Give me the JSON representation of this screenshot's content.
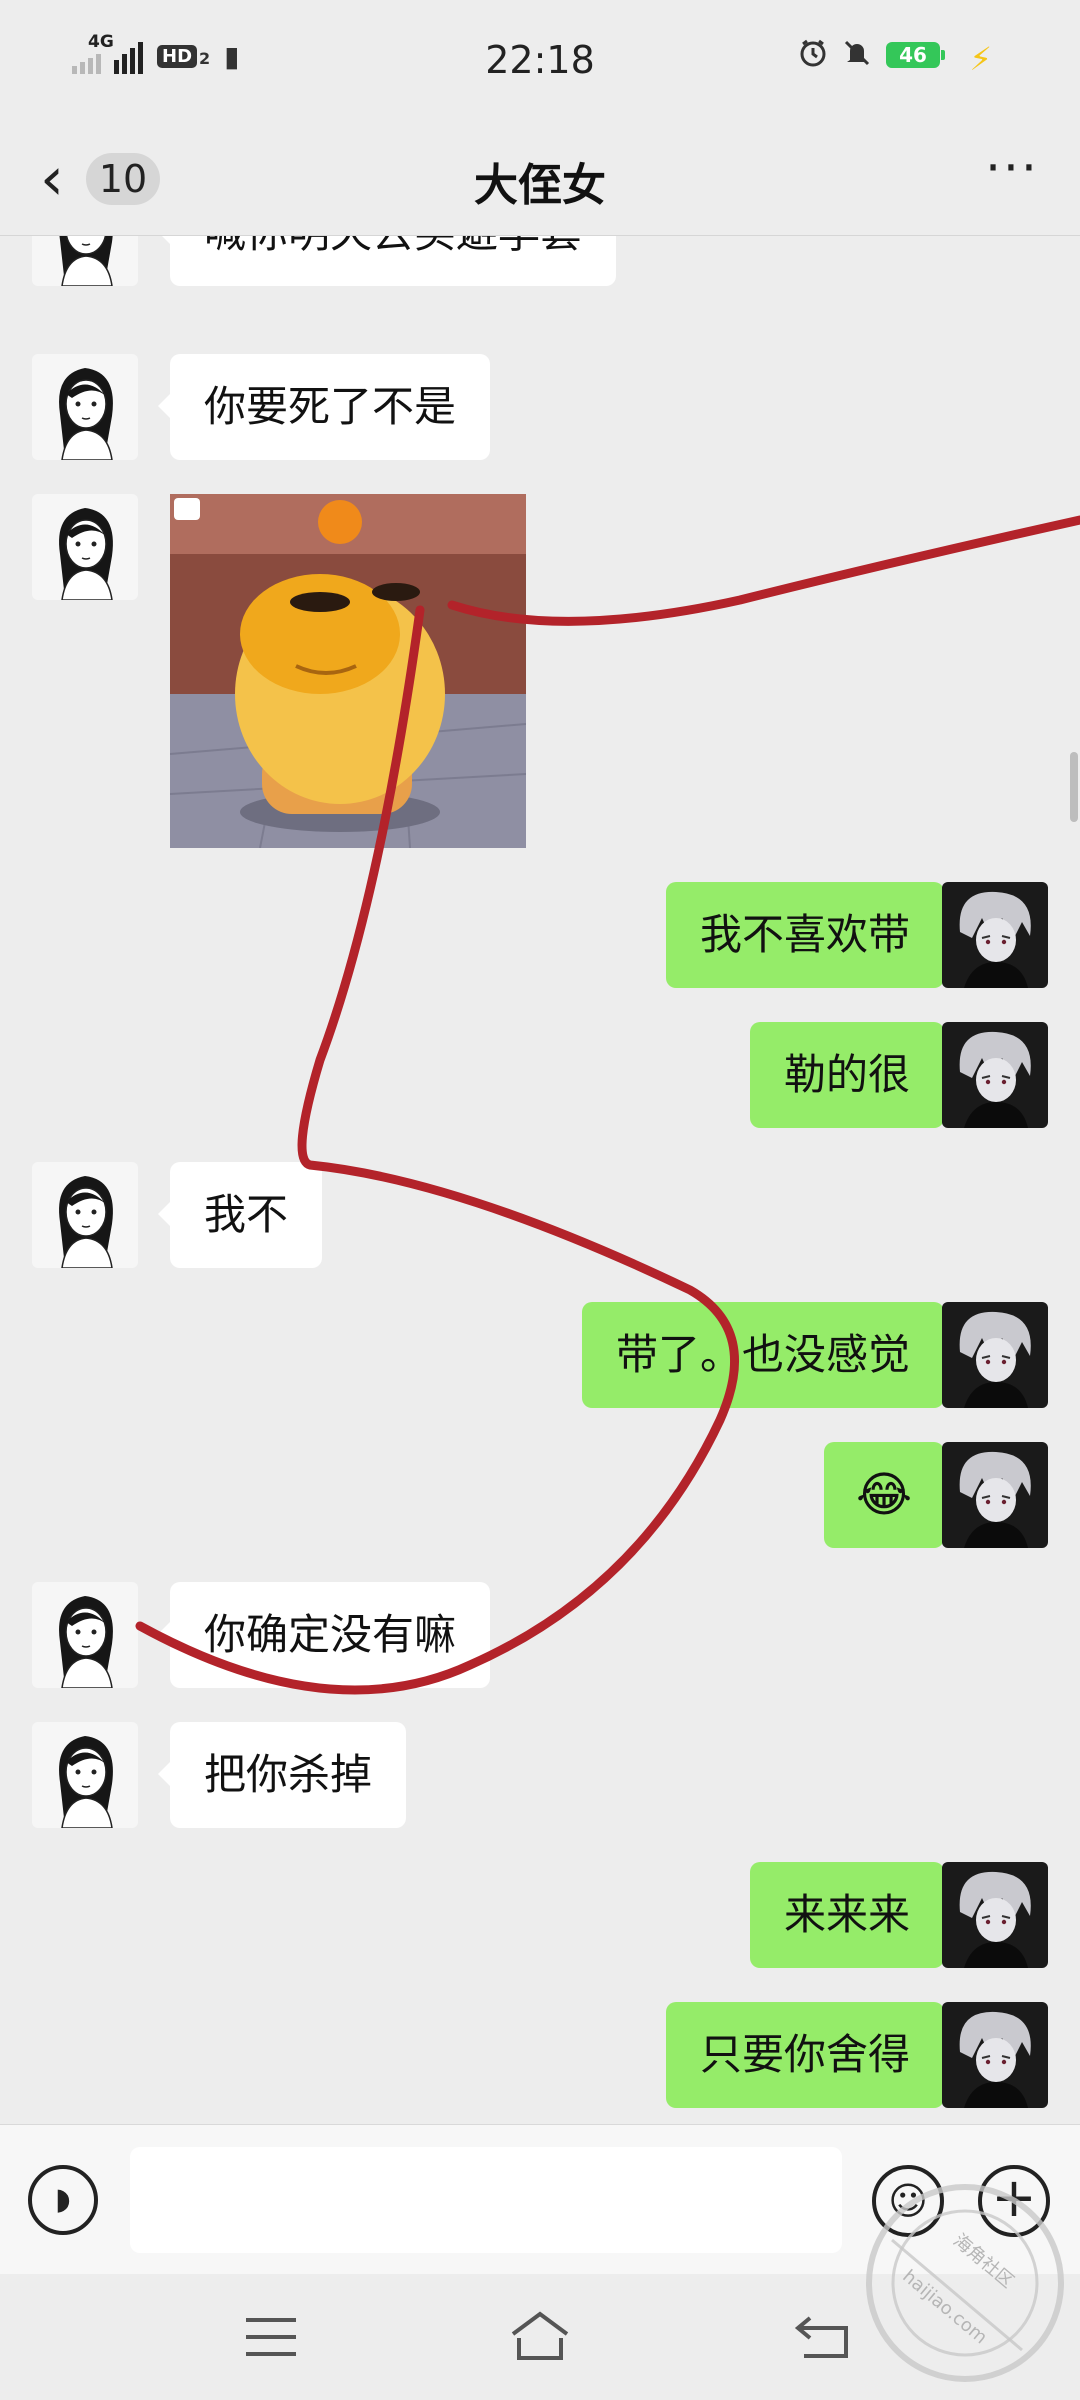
{
  "status_bar": {
    "network": "4G",
    "hd": "HD",
    "hd_sub": "2",
    "time": "22:18",
    "battery": "46",
    "icons": [
      "signal-icon",
      "book-icon",
      "alarm-icon",
      "mute-icon",
      "battery-icon",
      "charging-icon"
    ]
  },
  "header": {
    "back_badge": "10",
    "title": "大侄女",
    "more_label": "···"
  },
  "messages": [
    {
      "side": "in",
      "type": "text",
      "text": "喊你明天去买避孕套"
    },
    {
      "side": "in",
      "type": "text",
      "text": "你要死了不是"
    },
    {
      "side": "in",
      "type": "sticker",
      "sticker_name": "yellow-cartoon-sticker"
    },
    {
      "side": "out",
      "type": "text",
      "text": "我不喜欢带"
    },
    {
      "side": "out",
      "type": "text",
      "text": "勒的很"
    },
    {
      "side": "in",
      "type": "text",
      "text": "我不"
    },
    {
      "side": "out",
      "type": "text",
      "text": "带了。也没感觉"
    },
    {
      "side": "out",
      "type": "emoji",
      "text": "😂"
    },
    {
      "side": "in",
      "type": "text",
      "text": "你确定没有嘛"
    },
    {
      "side": "in",
      "type": "text",
      "text": "把你杀掉"
    },
    {
      "side": "out",
      "type": "text",
      "text": "来来来"
    },
    {
      "side": "out",
      "type": "text",
      "text": "只要你舍得"
    }
  ],
  "input_bar": {
    "text_value": "",
    "icons": [
      "voice-icon",
      "emoji-icon",
      "plus-icon"
    ]
  },
  "nav_bar": {
    "icons": [
      "menu-icon",
      "home-icon",
      "back-icon"
    ]
  },
  "watermark": {
    "line1": "海角社区",
    "line2": "haijiao.com"
  },
  "colors": {
    "background": "#ededed",
    "incoming_bubble": "#ffffff",
    "outgoing_bubble": "#95ec69",
    "annotation_stroke": "#b3232a",
    "battery": "#34c759"
  }
}
